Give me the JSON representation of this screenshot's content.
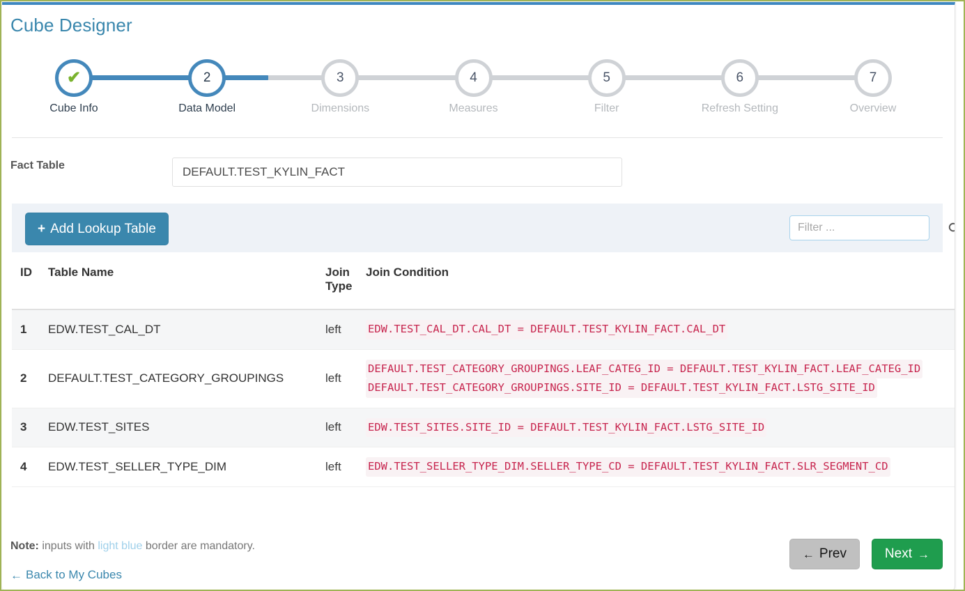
{
  "page": {
    "title": "Cube Designer",
    "accent_blue": "#3a87ad",
    "border_olive": "#9fb355",
    "code_color": "#c7254e"
  },
  "stepper": {
    "current": 2,
    "steps": [
      {
        "num": "✔",
        "label": "Cube Info",
        "state": "done"
      },
      {
        "num": "2",
        "label": "Data Model",
        "state": "active"
      },
      {
        "num": "3",
        "label": "Dimensions",
        "state": "todo"
      },
      {
        "num": "4",
        "label": "Measures",
        "state": "todo"
      },
      {
        "num": "5",
        "label": "Filter",
        "state": "todo"
      },
      {
        "num": "6",
        "label": "Refresh Setting",
        "state": "todo"
      },
      {
        "num": "7",
        "label": "Overview",
        "state": "todo"
      }
    ]
  },
  "fact_table": {
    "label": "Fact Table",
    "value": "DEFAULT.TEST_KYLIN_FACT"
  },
  "toolbar": {
    "add_lookup_label": "Add Lookup Table",
    "add_lookup_plus": "+",
    "filter_placeholder": "Filter ...",
    "filter_value": ""
  },
  "table": {
    "headers": {
      "id": "ID",
      "table_name": "Table Name",
      "join_type": "Join Type",
      "join_condition": "Join Condition"
    },
    "rows": [
      {
        "id": "1",
        "name": "EDW.TEST_CAL_DT",
        "join": "left",
        "conditions": [
          "EDW.TEST_CAL_DT.CAL_DT = DEFAULT.TEST_KYLIN_FACT.CAL_DT"
        ]
      },
      {
        "id": "2",
        "name": "DEFAULT.TEST_CATEGORY_GROUPINGS",
        "join": "left",
        "conditions": [
          "DEFAULT.TEST_CATEGORY_GROUPINGS.LEAF_CATEG_ID = DEFAULT.TEST_KYLIN_FACT.LEAF_CATEG_ID",
          "DEFAULT.TEST_CATEGORY_GROUPINGS.SITE_ID = DEFAULT.TEST_KYLIN_FACT.LSTG_SITE_ID"
        ]
      },
      {
        "id": "3",
        "name": "EDW.TEST_SITES",
        "join": "left",
        "conditions": [
          "EDW.TEST_SITES.SITE_ID = DEFAULT.TEST_KYLIN_FACT.LSTG_SITE_ID"
        ]
      },
      {
        "id": "4",
        "name": "EDW.TEST_SELLER_TYPE_DIM",
        "join": "left",
        "conditions": [
          "EDW.TEST_SELLER_TYPE_DIM.SELLER_TYPE_CD = DEFAULT.TEST_KYLIN_FACT.SLR_SEGMENT_CD"
        ]
      }
    ]
  },
  "footer": {
    "note_prefix": "Note:",
    "note_part1": " inputs with ",
    "note_highlight": "light blue",
    "note_part2": " border are mandatory.",
    "back_link": "Back to My Cubes",
    "back_arrow": "←",
    "prev_label": "Prev",
    "prev_arrow": "←",
    "next_label": "Next",
    "next_arrow": "→"
  }
}
